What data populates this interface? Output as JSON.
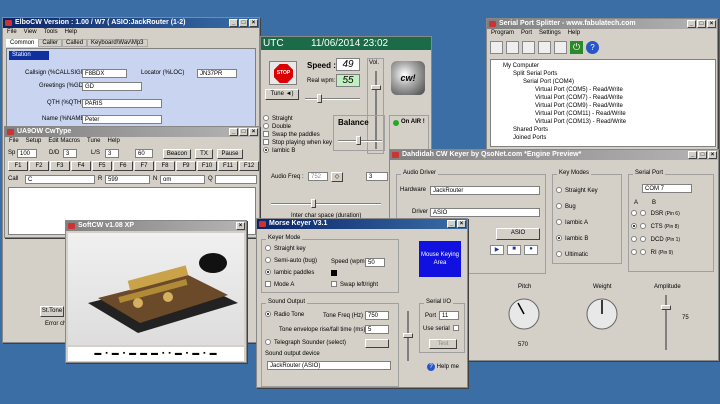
{
  "elbo": {
    "title": "ElboCW Version : 1.00 / W7  ( ASIO:JackRouter (1-2)",
    "menu": [
      "File",
      "View",
      "Tools",
      "Help"
    ],
    "tabs": [
      "Common",
      "Caller",
      "Called",
      "Keyboard\\Wav\\Mp3"
    ],
    "station_header": "Station",
    "callsign_label": "Callsign (%CALLSIGN)",
    "callsign": "F8BDX",
    "locator_label": "Locator (%LOC)",
    "locator": "JN37PR",
    "greetings_label": "Greetings (%GD)",
    "greetings": "GD",
    "qth_label": "QTH (%QTH)",
    "qth": "PARIS",
    "name_label": "Name (%NAME)",
    "name": "Peter",
    "st_tone": "St.Tone",
    "error": "Error ch"
  },
  "utc": {
    "label": "UTC",
    "datetime": "11/06/2014 23:02",
    "speed_label": "Speed :",
    "speed": "49",
    "real_wpm_label": "Real wpm:",
    "real_wpm": "55",
    "vol_label": "Vol.",
    "stop": "STOP",
    "tune": "Tune",
    "options": [
      "Straight",
      "Double",
      "Swap the paddles",
      "Stop playing when key",
      "Iambic B"
    ],
    "balance_label": "Balance",
    "on_air": "On AIR !",
    "audio_freq_label": "Audio Freq :",
    "audio_freq": "752",
    "spacing": "3",
    "inter_char_label": "Inter char space (duration)"
  },
  "ua9ow": {
    "title": "UA9OW CwType",
    "menu": [
      "File",
      "Setup",
      "Edit Macros",
      "Tune",
      "Help"
    ],
    "sp_label": "Sp",
    "sp": "100",
    "dd_label": "D/D",
    "dd": "3",
    "ls_label": "L/S",
    "ls": "3",
    "sixty": "60",
    "beacon": "Beacon",
    "tx": "TX",
    "pause": "Pause",
    "fkeys": [
      "F1",
      "F2",
      "F3",
      "F4",
      "F5",
      "F6",
      "F7",
      "F8",
      "F9",
      "F10",
      "F11",
      "F12"
    ],
    "call_label": "Call",
    "call": "C",
    "rst_label": "R",
    "rst": "599",
    "name_label": "N",
    "name": "om",
    "qth_label": "Q"
  },
  "softcw": {
    "title": "SoftCW v1.08 XP",
    "morse": "▬ ▪ ▬ ▪ ▬ ▬ ▬ ▪ ▪ ▬ ▪ ▬ ▪ ▬"
  },
  "splitter": {
    "title": "Serial Port Splitter - www.fabulatech.com",
    "menu": [
      "Program",
      "Port",
      "Settings",
      "Help"
    ],
    "tree": [
      "My Computer",
      "Split Serial Ports",
      "Serial Port (COM4)",
      "Virtual Port (COM5) - Read/Write",
      "Virtual Port (COM7) - Read/Write",
      "Virtual Port (COM9) - Read/Write",
      "Virtual Port (COM11) - Read/Write",
      "Virtual Port (COM13) - Read/Write",
      "Shared Ports",
      "Joined Ports"
    ]
  },
  "dahdidah": {
    "title": "Dahdidah CW Keyer by QsoNet.com  *Engine Preview*",
    "audio_driver": "Audio Driver",
    "hardware_label": "Hardware",
    "hardware": "JackRouter",
    "driver_label": "Driver",
    "driver": "ASIO",
    "asio_button": "ASIO",
    "key_modes": "Key Modes",
    "modes": [
      "Straight Key",
      "Bug",
      "Iambic A",
      "Iambic B",
      "Ultimatic"
    ],
    "serial_port": "Serial Port",
    "com": "COM 7",
    "a_label": "A",
    "b_label": "B",
    "pins": [
      [
        "DSR",
        "(Pin 6)"
      ],
      [
        "CTS",
        "(Pin 8)"
      ],
      [
        "DCD",
        "(Pin 1)"
      ],
      [
        "RI",
        "(Pin 9)"
      ]
    ],
    "pitch_label": "Pitch",
    "pitch": "570",
    "weight_label": "Weight",
    "amplitude_label": "Amplitude",
    "amplitude": "75"
  },
  "morse": {
    "title": "Morse Keyer V3.1",
    "keyer_mode": "Keyer Mode",
    "modes": [
      "Straight key",
      "Semi-auto (bug)",
      "Iambic paddles",
      "Mode A"
    ],
    "speed_label": "Speed (wpm)",
    "speed": "50",
    "swap": "Swap left/right",
    "mouse_area": "Mouse Keying Area",
    "sound_output": "Sound Output",
    "radio_tone": "Radio Tone",
    "tone_freq_label": "Tone Freq (Hz)",
    "tone_freq": "750",
    "envelope_label": "Tone envelope rise/fall time (ms)",
    "envelope": "5",
    "telegraph": "Telegraph Sounder (select)",
    "device_label": "Sound output device",
    "device": "JackRouter (ASIO)",
    "serial_io": "Serial I/O",
    "port_label": "Port",
    "port": "11",
    "use_serial": "Use serial",
    "test": "Test",
    "help": "Help me"
  }
}
